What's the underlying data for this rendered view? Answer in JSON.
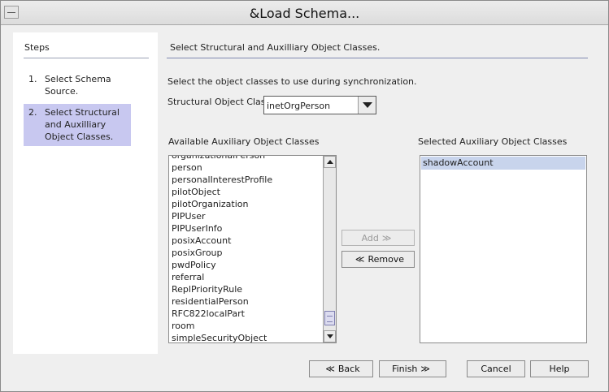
{
  "window": {
    "title": "&Load Schema..."
  },
  "steps": {
    "title": "Steps",
    "items": [
      {
        "num": "1.",
        "label": "Select Schema Source."
      },
      {
        "num": "2.",
        "label": "Select Structural and Auxilliary Object Classes."
      }
    ]
  },
  "main": {
    "title": "Select Structural and Auxilliary Object Classes.",
    "instruction": "Select the object classes to use during synchronization.",
    "structural_label": "Structural Object Class :",
    "structural_value": "inetOrgPerson",
    "available_label": "Available Auxiliary Object Classes",
    "selected_label": "Selected Auxiliary Object Classes",
    "available_items": [
      "organizationalPerson",
      "person",
      "personalInterestProfile",
      "pilotObject",
      "pilotOrganization",
      "PIPUser",
      "PIPUserInfo",
      "posixAccount",
      "posixGroup",
      "pwdPolicy",
      "referral",
      "ReplPriorityRule",
      "residentialPerson",
      "RFC822localPart",
      "room",
      "simpleSecurityObject"
    ],
    "selected_items": [
      "shadowAccount"
    ]
  },
  "buttons": {
    "add": "Add",
    "remove": "Remove",
    "back": "Back",
    "finish": "Finish",
    "cancel": "Cancel",
    "help": "Help"
  },
  "icons": {
    "add": "chevron-right-icon",
    "remove": "chevron-left-icon",
    "back": "chevron-left-icon",
    "finish": "chevron-right-icon"
  },
  "colors": {
    "step_highlight": "#c8c8f0",
    "list_selection": "#c8d4ec"
  }
}
